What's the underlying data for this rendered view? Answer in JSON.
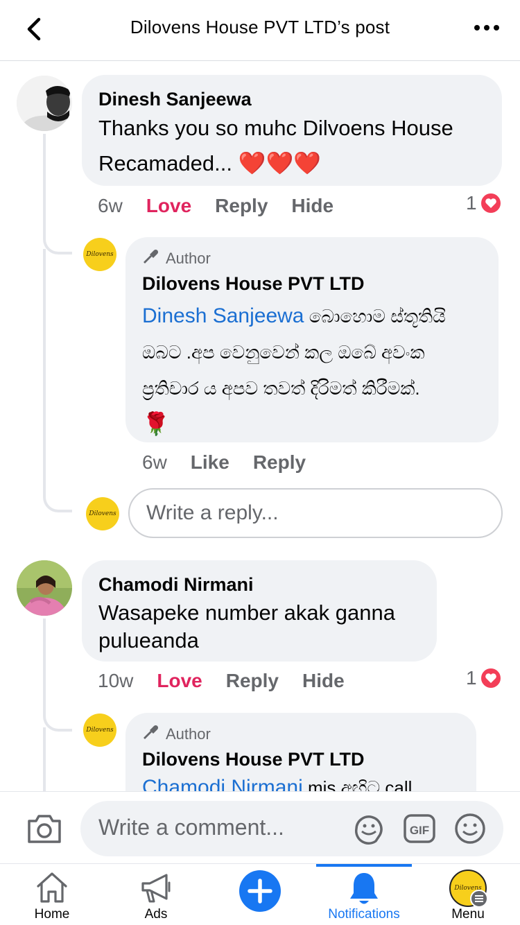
{
  "header": {
    "title": "Dilovens House PVT LTD’s post"
  },
  "logo_text": "Dilovens",
  "comments": [
    {
      "name": "Dinesh Sanjeewa",
      "text_line1": "Thanks you so muhc Dilvoens House",
      "text_line2": "Recamaded... ",
      "emoji": "❤️❤️❤️",
      "time": "6w",
      "action1": "Love",
      "action2": "Reply",
      "action3": "Hide",
      "reaction_count": "1",
      "reply": {
        "badge": "Author",
        "name": "Dilovens House PVT LTD",
        "mention": "Dinesh Sanjeewa",
        "text_line1": " බොහොම ස්තූතියි",
        "text_line2": "ඔබට .අප වෙනුවෙන් කල ඔබේ අවංක",
        "text_line3": "ප්‍රතිචාර ය අපව තවත් දිරිමත් කිරීමක්.",
        "emoji": "🌹",
        "time": "6w",
        "action1": "Like",
        "action2": "Reply"
      },
      "reply_placeholder": "Write a reply..."
    },
    {
      "name": "Chamodi Nirmani",
      "text_line1": "Wasapeke number akak ganna",
      "text_line2": "pulueanda",
      "time": "10w",
      "action1": "Love",
      "action2": "Reply",
      "action3": "Hide",
      "reaction_count": "1",
      "reply": {
        "badge": "Author",
        "name": "Dilovens House PVT LTD",
        "mention": "Chamodi Nirmani",
        "text_line1": " mis අඟිට call"
      }
    }
  ],
  "composer": {
    "placeholder": "Write a comment...",
    "gif_label": "GIF"
  },
  "nav": {
    "home": "Home",
    "ads": "Ads",
    "notifications": "Notifications",
    "menu": "Menu"
  },
  "colors": {
    "accent": "#1877f2",
    "love": "#e0245e",
    "mention": "#1b6fd2",
    "bubble": "#f0f2f5",
    "logo": "#f7cf1c"
  }
}
